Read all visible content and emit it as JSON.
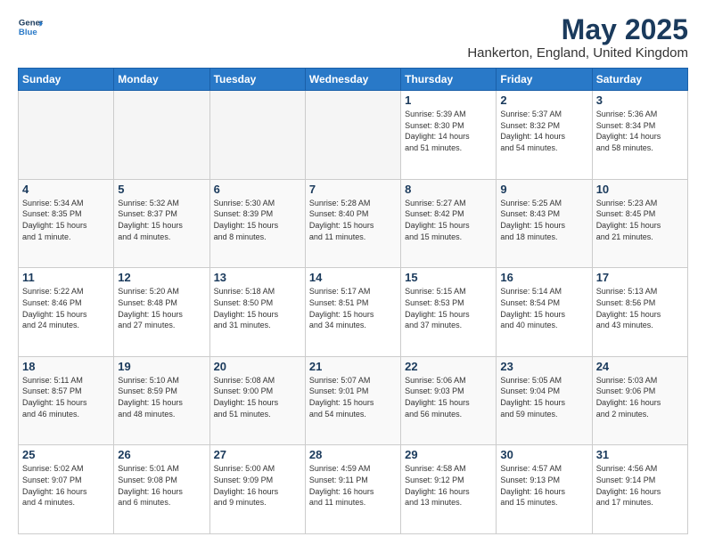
{
  "header": {
    "logo_line1": "General",
    "logo_line2": "Blue",
    "title": "May 2025",
    "subtitle": "Hankerton, England, United Kingdom"
  },
  "days_of_week": [
    "Sunday",
    "Monday",
    "Tuesday",
    "Wednesday",
    "Thursday",
    "Friday",
    "Saturday"
  ],
  "weeks": [
    [
      {
        "day": "",
        "info": ""
      },
      {
        "day": "",
        "info": ""
      },
      {
        "day": "",
        "info": ""
      },
      {
        "day": "",
        "info": ""
      },
      {
        "day": "1",
        "info": "Sunrise: 5:39 AM\nSunset: 8:30 PM\nDaylight: 14 hours\nand 51 minutes."
      },
      {
        "day": "2",
        "info": "Sunrise: 5:37 AM\nSunset: 8:32 PM\nDaylight: 14 hours\nand 54 minutes."
      },
      {
        "day": "3",
        "info": "Sunrise: 5:36 AM\nSunset: 8:34 PM\nDaylight: 14 hours\nand 58 minutes."
      }
    ],
    [
      {
        "day": "4",
        "info": "Sunrise: 5:34 AM\nSunset: 8:35 PM\nDaylight: 15 hours\nand 1 minute."
      },
      {
        "day": "5",
        "info": "Sunrise: 5:32 AM\nSunset: 8:37 PM\nDaylight: 15 hours\nand 4 minutes."
      },
      {
        "day": "6",
        "info": "Sunrise: 5:30 AM\nSunset: 8:39 PM\nDaylight: 15 hours\nand 8 minutes."
      },
      {
        "day": "7",
        "info": "Sunrise: 5:28 AM\nSunset: 8:40 PM\nDaylight: 15 hours\nand 11 minutes."
      },
      {
        "day": "8",
        "info": "Sunrise: 5:27 AM\nSunset: 8:42 PM\nDaylight: 15 hours\nand 15 minutes."
      },
      {
        "day": "9",
        "info": "Sunrise: 5:25 AM\nSunset: 8:43 PM\nDaylight: 15 hours\nand 18 minutes."
      },
      {
        "day": "10",
        "info": "Sunrise: 5:23 AM\nSunset: 8:45 PM\nDaylight: 15 hours\nand 21 minutes."
      }
    ],
    [
      {
        "day": "11",
        "info": "Sunrise: 5:22 AM\nSunset: 8:46 PM\nDaylight: 15 hours\nand 24 minutes."
      },
      {
        "day": "12",
        "info": "Sunrise: 5:20 AM\nSunset: 8:48 PM\nDaylight: 15 hours\nand 27 minutes."
      },
      {
        "day": "13",
        "info": "Sunrise: 5:18 AM\nSunset: 8:50 PM\nDaylight: 15 hours\nand 31 minutes."
      },
      {
        "day": "14",
        "info": "Sunrise: 5:17 AM\nSunset: 8:51 PM\nDaylight: 15 hours\nand 34 minutes."
      },
      {
        "day": "15",
        "info": "Sunrise: 5:15 AM\nSunset: 8:53 PM\nDaylight: 15 hours\nand 37 minutes."
      },
      {
        "day": "16",
        "info": "Sunrise: 5:14 AM\nSunset: 8:54 PM\nDaylight: 15 hours\nand 40 minutes."
      },
      {
        "day": "17",
        "info": "Sunrise: 5:13 AM\nSunset: 8:56 PM\nDaylight: 15 hours\nand 43 minutes."
      }
    ],
    [
      {
        "day": "18",
        "info": "Sunrise: 5:11 AM\nSunset: 8:57 PM\nDaylight: 15 hours\nand 46 minutes."
      },
      {
        "day": "19",
        "info": "Sunrise: 5:10 AM\nSunset: 8:59 PM\nDaylight: 15 hours\nand 48 minutes."
      },
      {
        "day": "20",
        "info": "Sunrise: 5:08 AM\nSunset: 9:00 PM\nDaylight: 15 hours\nand 51 minutes."
      },
      {
        "day": "21",
        "info": "Sunrise: 5:07 AM\nSunset: 9:01 PM\nDaylight: 15 hours\nand 54 minutes."
      },
      {
        "day": "22",
        "info": "Sunrise: 5:06 AM\nSunset: 9:03 PM\nDaylight: 15 hours\nand 56 minutes."
      },
      {
        "day": "23",
        "info": "Sunrise: 5:05 AM\nSunset: 9:04 PM\nDaylight: 15 hours\nand 59 minutes."
      },
      {
        "day": "24",
        "info": "Sunrise: 5:03 AM\nSunset: 9:06 PM\nDaylight: 16 hours\nand 2 minutes."
      }
    ],
    [
      {
        "day": "25",
        "info": "Sunrise: 5:02 AM\nSunset: 9:07 PM\nDaylight: 16 hours\nand 4 minutes."
      },
      {
        "day": "26",
        "info": "Sunrise: 5:01 AM\nSunset: 9:08 PM\nDaylight: 16 hours\nand 6 minutes."
      },
      {
        "day": "27",
        "info": "Sunrise: 5:00 AM\nSunset: 9:09 PM\nDaylight: 16 hours\nand 9 minutes."
      },
      {
        "day": "28",
        "info": "Sunrise: 4:59 AM\nSunset: 9:11 PM\nDaylight: 16 hours\nand 11 minutes."
      },
      {
        "day": "29",
        "info": "Sunrise: 4:58 AM\nSunset: 9:12 PM\nDaylight: 16 hours\nand 13 minutes."
      },
      {
        "day": "30",
        "info": "Sunrise: 4:57 AM\nSunset: 9:13 PM\nDaylight: 16 hours\nand 15 minutes."
      },
      {
        "day": "31",
        "info": "Sunrise: 4:56 AM\nSunset: 9:14 PM\nDaylight: 16 hours\nand 17 minutes."
      }
    ]
  ]
}
